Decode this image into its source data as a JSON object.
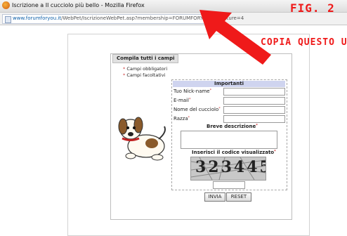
{
  "window": {
    "title": "Iscrizione a Il cucciolo più bello - Mozilla Firefox",
    "figure_label": "FIG. 2"
  },
  "address_bar": {
    "url_domain": "www.forumforyou.it",
    "url_path": "/WebPet/IscrizioneWebPet.asp?membership=FORUMFORYOU&structure=4"
  },
  "annotation": {
    "text": "COPIA QUESTO URL",
    "color": "#ef1a1a"
  },
  "form": {
    "panel_title": "Compila tutti i campi",
    "legend": {
      "required": "Campi obbligatori",
      "optional": "Campi facoltativi"
    },
    "section_important": "Importanti",
    "fields": {
      "nickname": "Tuo Nick-name",
      "email": "E-mail",
      "puppy_name": "Nome del cucciolo",
      "breed": "Razza"
    },
    "short_description": "Breve descrizione",
    "captcha_label": "Inserisci il codice visualizzato",
    "captcha_code": "323445",
    "submit_label": "INVIA",
    "reset_label": "RESET"
  },
  "colors": {
    "section_header_bg": "#cfd4ef",
    "accent_red": "#ef1a1a"
  }
}
